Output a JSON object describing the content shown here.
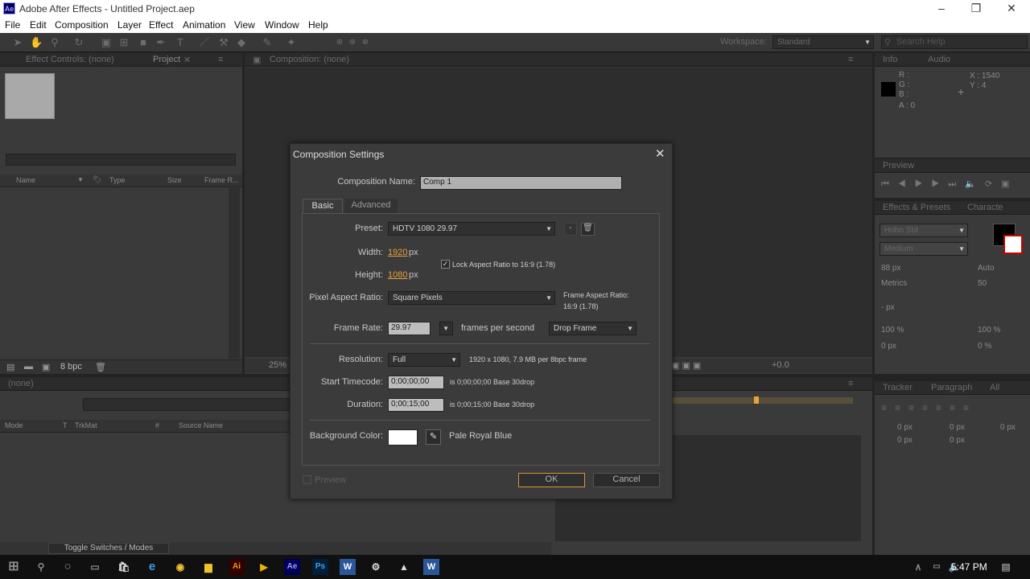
{
  "window": {
    "title": "Adobe After Effects - Untitled Project.aep",
    "app_icon": "Ae"
  },
  "menu": [
    "File",
    "Edit",
    "Composition",
    "Layer",
    "Effect",
    "Animation",
    "View",
    "Window",
    "Help"
  ],
  "workspace": {
    "label": "Workspace:",
    "value": "Standard"
  },
  "search_help": {
    "placeholder": "Search Help"
  },
  "left_panel": {
    "tab_effect_controls": "Effect Controls: (none)",
    "tab_project": "Project",
    "cols": [
      "Name",
      "Type",
      "Size",
      "Frame R..."
    ],
    "bpc": "8 bpc"
  },
  "comp_panel": {
    "tab": "Composition: (none)",
    "zoom": "25%",
    "exposure": "+0.0"
  },
  "info_panel": {
    "tab_info": "Info",
    "tab_audio": "Audio",
    "r": "R :",
    "g": "G :",
    "b": "B :",
    "a": "A : 0",
    "x": "X : 1540",
    "y": "Y : 4"
  },
  "preview_panel": {
    "tab": "Preview"
  },
  "character_panel": {
    "tab_effects": "Effects & Presets",
    "tab_character": "Characte",
    "font": "Hobo Std",
    "style": "Medium",
    "size": "88 px",
    "leading": "Auto",
    "kerning": "Metrics",
    "tracking": "50",
    "stroke": "- px",
    "vscale": "100 %",
    "hscale": "100 %",
    "baseline": "0 px",
    "tsume": "0 %"
  },
  "paragraph_panel": {
    "tab_tracker": "Tracker",
    "tab_paragraph": "Paragraph",
    "tab_all": "All",
    "ind1": "0 px",
    "ind2": "0 px",
    "ind3": "0 px",
    "sp1": "0 px",
    "sp2": "0 px"
  },
  "timeline": {
    "tab": "(none)",
    "cols": [
      "Mode",
      "T",
      "TrkMat",
      "#",
      "Source Name"
    ],
    "toggle": "Toggle Switches / Modes"
  },
  "dialog": {
    "title": "Composition Settings",
    "comp_name_label": "Composition Name:",
    "comp_name": "Comp 1",
    "tab_basic": "Basic",
    "tab_advanced": "Advanced",
    "preset_label": "Preset:",
    "preset": "HDTV 1080 29.97",
    "width_label": "Width:",
    "width": "1920",
    "height_label": "Height:",
    "height": "1080",
    "px": "px",
    "lock_aspect": "Lock Aspect Ratio to 16:9 (1.78)",
    "par_label": "Pixel Aspect Ratio:",
    "par": "Square Pixels",
    "far_label": "Frame Aspect Ratio:",
    "far": "16:9 (1.78)",
    "fr_label": "Frame Rate:",
    "fr": "29.97",
    "fps": "frames per second",
    "drop": "Drop Frame",
    "res_label": "Resolution:",
    "res": "Full",
    "res_info": "1920 x 1080, 7.9 MB per 8bpc frame",
    "start_label": "Start Timecode:",
    "start": "0;00;00;00",
    "start_info": "is 0;00;00;00  Base 30drop",
    "dur_label": "Duration:",
    "dur": "0;00;15;00",
    "dur_info": "is 0;00;15;00  Base 30drop",
    "bg_label": "Background Color:",
    "bg_name": "Pale Royal Blue",
    "preview": "Preview",
    "ok": "OK",
    "cancel": "Cancel"
  },
  "taskbar": {
    "time": "5:47 PM"
  }
}
